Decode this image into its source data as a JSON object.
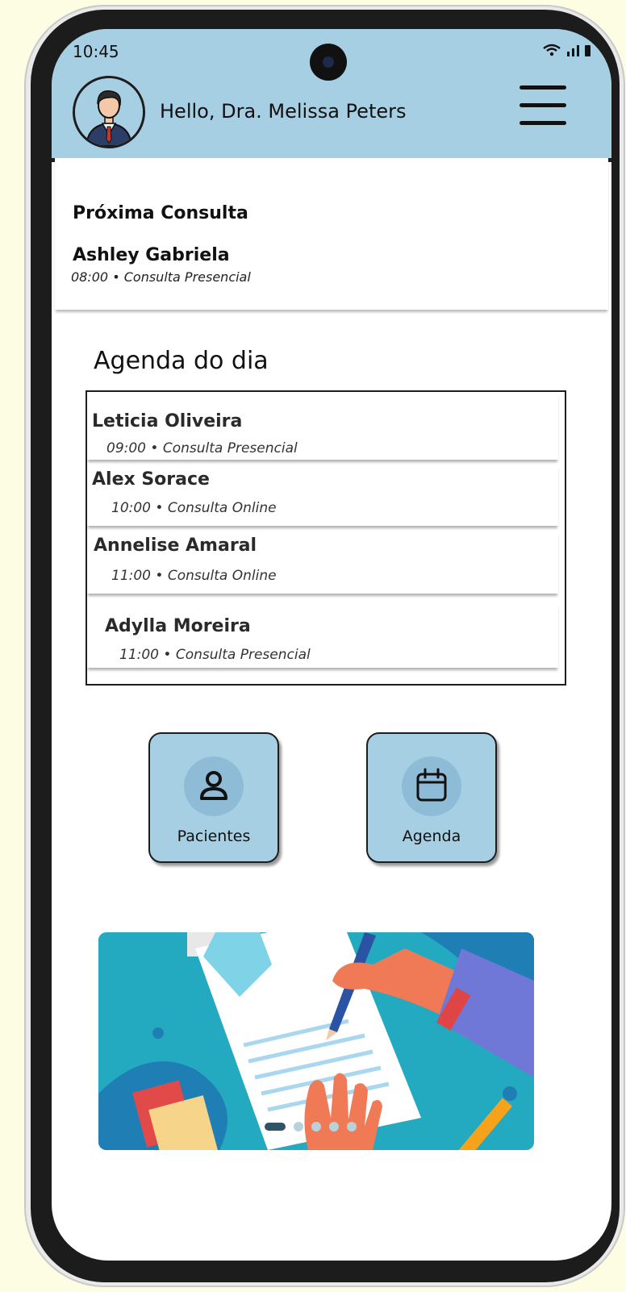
{
  "status_bar": {
    "time": "10:45",
    "icons": "wifi signal battery"
  },
  "header": {
    "greeting": "Hello, Dra. Melissa Peters",
    "avatar": "doctor-avatar",
    "menu_icon": "hamburger-menu-icon"
  },
  "next_consultation": {
    "title": "Próxima Consulta",
    "patient": "Ashley Gabriela",
    "time": "08:00",
    "type": "Consulta Presencial"
  },
  "agenda": {
    "title": "Agenda do dia",
    "items": [
      {
        "name": "Leticia Oliveira",
        "time": "09:00",
        "type": "Consulta Presencial"
      },
      {
        "name": "Alex Sorace",
        "time": "10:00",
        "type": "Consulta Online"
      },
      {
        "name": "Annelise Amaral",
        "time": "11:00",
        "type": "Consulta Online"
      },
      {
        "name": "Adylla Moreira",
        "time": "11:00",
        "type": "Consulta Presencial"
      }
    ]
  },
  "quick_actions": {
    "patients": {
      "label": "Pacientes",
      "icon": "person-icon"
    },
    "agenda": {
      "label": "Agenda",
      "icon": "calendar-icon"
    }
  },
  "carousel": {
    "image": "document-writing-illustration",
    "slide_count": 5,
    "active_slide": 1
  },
  "colors": {
    "header_bg": "#a7cfe3",
    "tile_bg": "#a7cfe3",
    "page_bg": "#fdfde3"
  }
}
